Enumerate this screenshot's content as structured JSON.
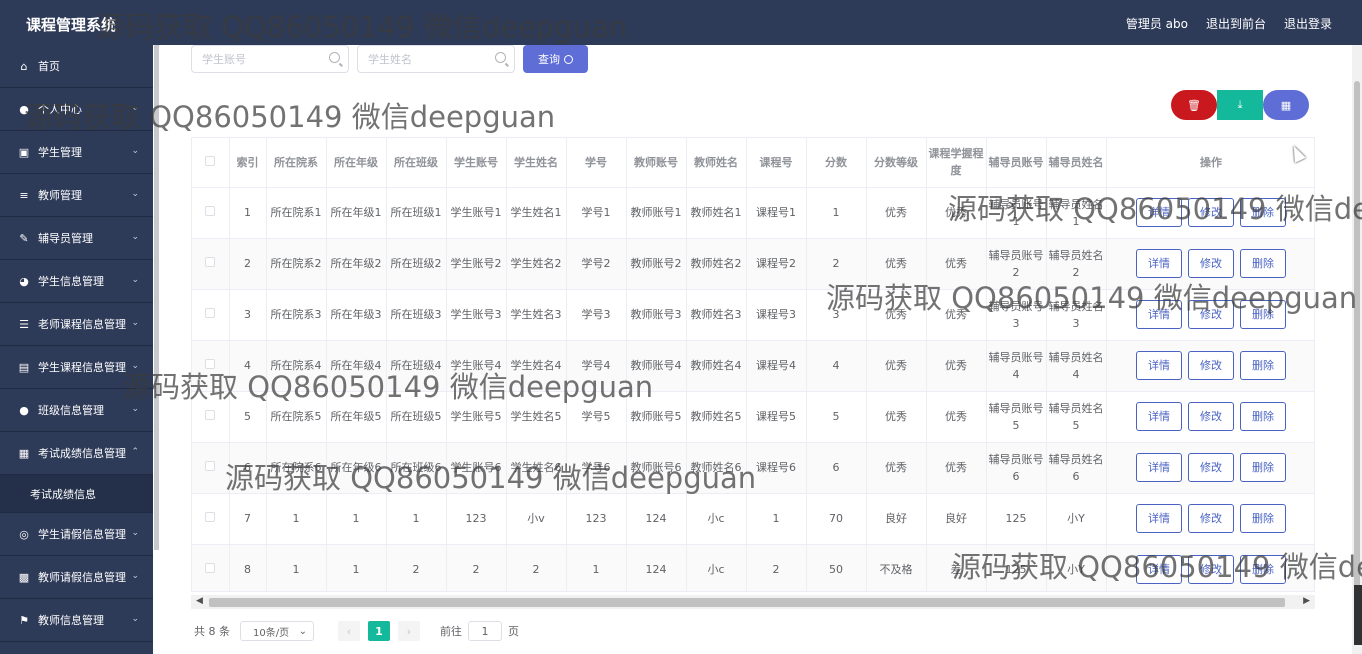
{
  "topbar": {
    "title": "课程管理系统",
    "admin": "管理员 abo",
    "exit_front": "退出到前台",
    "logout": "退出登录"
  },
  "sidebar": {
    "items": [
      {
        "label": "首页",
        "icon": "home-icon",
        "expandable": false
      },
      {
        "label": "个人中心",
        "icon": "user-icon",
        "expandable": true
      },
      {
        "label": "学生管理",
        "icon": "student-icon",
        "expandable": true
      },
      {
        "label": "教师管理",
        "icon": "sliders-icon",
        "expandable": true
      },
      {
        "label": "辅导员管理",
        "icon": "pen-icon",
        "expandable": true
      },
      {
        "label": "学生信息管理",
        "icon": "compass-icon",
        "expandable": true
      },
      {
        "label": "老师课程信息管理",
        "icon": "list-icon",
        "expandable": true
      },
      {
        "label": "学生课程信息管理",
        "icon": "doc-icon",
        "expandable": true
      },
      {
        "label": "班级信息管理",
        "icon": "user-icon",
        "expandable": true
      },
      {
        "label": "考试成绩信息管理",
        "icon": "table-icon",
        "expandable": true,
        "expanded": true
      },
      {
        "label": "学生请假信息管理",
        "icon": "mic-icon",
        "expandable": true
      },
      {
        "label": "教师请假信息管理",
        "icon": "ticket-icon",
        "expandable": true
      },
      {
        "label": "教师信息管理",
        "icon": "flag-icon",
        "expandable": true
      }
    ],
    "submenu": "考试成绩信息"
  },
  "search": {
    "student_account_placeholder": "学生账号",
    "student_name_placeholder": "学生姓名",
    "query_label": "查询"
  },
  "table": {
    "headers": [
      "",
      "索引",
      "所在院系",
      "所在年级",
      "所在班级",
      "学生账号",
      "学生姓名",
      "学号",
      "教师账号",
      "教师姓名",
      "课程号",
      "分数",
      "分数等级",
      "课程学握程度",
      "辅导员账号",
      "辅导员姓名",
      "操作"
    ],
    "rows": [
      [
        "1",
        "所在院系1",
        "所在年级1",
        "所在班级1",
        "学生账号1",
        "学生姓名1",
        "学号1",
        "教师账号1",
        "教师姓名1",
        "课程号1",
        "1",
        "优秀",
        "优秀",
        "辅导员账号1",
        "辅导员姓名1"
      ],
      [
        "2",
        "所在院系2",
        "所在年级2",
        "所在班级2",
        "学生账号2",
        "学生姓名2",
        "学号2",
        "教师账号2",
        "教师姓名2",
        "课程号2",
        "2",
        "优秀",
        "优秀",
        "辅导员账号2",
        "辅导员姓名2"
      ],
      [
        "3",
        "所在院系3",
        "所在年级3",
        "所在班级3",
        "学生账号3",
        "学生姓名3",
        "学号3",
        "教师账号3",
        "教师姓名3",
        "课程号3",
        "3",
        "优秀",
        "优秀",
        "辅导员账号3",
        "辅导员姓名3"
      ],
      [
        "4",
        "所在院系4",
        "所在年级4",
        "所在班级4",
        "学生账号4",
        "学生姓名4",
        "学号4",
        "教师账号4",
        "教师姓名4",
        "课程号4",
        "4",
        "优秀",
        "优秀",
        "辅导员账号4",
        "辅导员姓名4"
      ],
      [
        "5",
        "所在院系5",
        "所在年级5",
        "所在班级5",
        "学生账号5",
        "学生姓名5",
        "学号5",
        "教师账号5",
        "教师姓名5",
        "课程号5",
        "5",
        "优秀",
        "优秀",
        "辅导员账号5",
        "辅导员姓名5"
      ],
      [
        "6",
        "所在院系6",
        "所在年级6",
        "所在班级6",
        "学生账号6",
        "学生姓名6",
        "学号6",
        "教师账号6",
        "教师姓名6",
        "课程号6",
        "6",
        "优秀",
        "优秀",
        "辅导员账号6",
        "辅导员姓名6"
      ],
      [
        "7",
        "1",
        "1",
        "1",
        "123",
        "小v",
        "123",
        "124",
        "小c",
        "1",
        "70",
        "良好",
        "良好",
        "125",
        "小Y"
      ],
      [
        "8",
        "1",
        "1",
        "2",
        "2",
        "2",
        "1",
        "124",
        "小c",
        "2",
        "50",
        "不及格",
        "差",
        "125",
        "小Y"
      ]
    ],
    "actions": {
      "detail": "详情",
      "edit": "修改",
      "delete": "删除"
    }
  },
  "pager": {
    "total": "共 8 条",
    "page_size": "10条/页",
    "current_page": "1",
    "goto_label": "前往",
    "goto_value": "1",
    "page_unit": "页"
  },
  "watermark": "源码获取 QQ86050149 微信deepguan",
  "colors": {
    "sidebar_bg": "#2d3a58",
    "primary": "#5e6ed6",
    "danger": "#c9191e",
    "success": "#13b99a"
  }
}
